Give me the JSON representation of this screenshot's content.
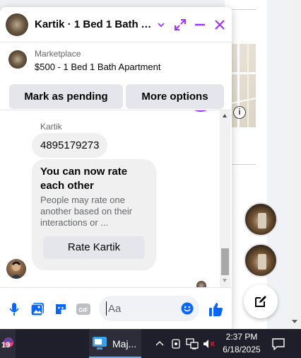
{
  "chat": {
    "title": "Kartik · 1 Bed 1 Bath A…",
    "listing": {
      "label": "Marketplace",
      "title": "$500 - 1 Bed 1 Bath Apartment"
    },
    "buttons": {
      "mark_pending": "Mark as pending",
      "more_options": "More options"
    },
    "messages": {
      "sender": "Kartik",
      "phone": "4895179273"
    },
    "rating_card": {
      "heading": "You can now rate each other",
      "body": "People may rate one another based on their interactions or ...",
      "button": "Rate Kartik"
    },
    "composer": {
      "placeholder": "Aa",
      "value": ""
    },
    "accent_color": "#a033ff",
    "brand_blue": "#0866ff"
  },
  "icons": {
    "header": [
      "chevron-down-icon",
      "expand-icon",
      "minimize-icon",
      "close-icon"
    ],
    "composer": [
      "microphone-icon",
      "photo-icon",
      "sticker-icon",
      "gif-icon",
      "emoji-icon",
      "thumbs-up-icon"
    ],
    "page": [
      "info-icon",
      "compose-icon"
    ]
  },
  "taskbar": {
    "weather_temp": "19",
    "app_label": "Maj...",
    "time": "2:37 PM",
    "date": "6/18/2025"
  }
}
